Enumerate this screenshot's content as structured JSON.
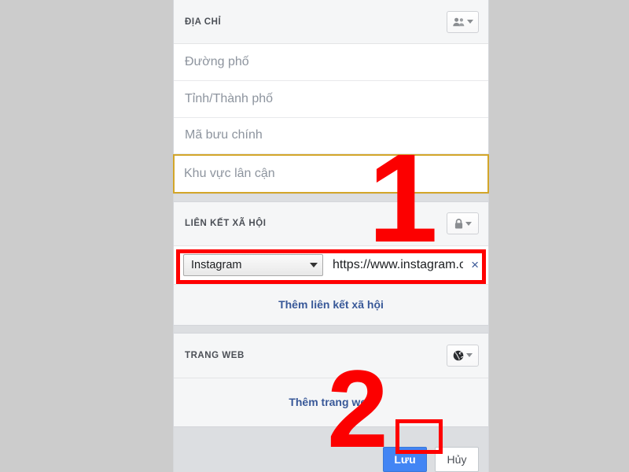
{
  "card": {
    "sections": [
      {
        "id": "address",
        "title": "ĐỊA CHỈ",
        "audience_icon": "friends-icon",
        "fields": [
          {
            "placeholder": "Đường phố",
            "focused": false
          },
          {
            "placeholder": "Tỉnh/Thành phố",
            "focused": false
          },
          {
            "placeholder": "Mã bưu chính",
            "focused": false
          },
          {
            "placeholder": "Khu vực lân cận",
            "focused": true
          }
        ]
      },
      {
        "id": "social-links",
        "title": "LIÊN KẾT XÃ HỘI",
        "audience_icon": "lock-icon",
        "link": {
          "service": "Instagram",
          "url": "https://www.instagram.c",
          "clear_label": "×"
        },
        "add_label": "Thêm liên kết xã hội"
      },
      {
        "id": "website",
        "title": "TRANG WEB",
        "audience_icon": "globe-icon",
        "add_label": "Thêm trang web"
      }
    ]
  },
  "footer": {
    "save_label": "Lưu",
    "cancel_label": "Hủy"
  },
  "annotations": {
    "step_one": "1",
    "step_two": "2"
  },
  "colors": {
    "accent_blue": "#4285f4",
    "link_blue": "#385898",
    "annotation_red": "#fc0000",
    "focus_gold": "#d3a62a",
    "page_gray": "#cccccc"
  }
}
